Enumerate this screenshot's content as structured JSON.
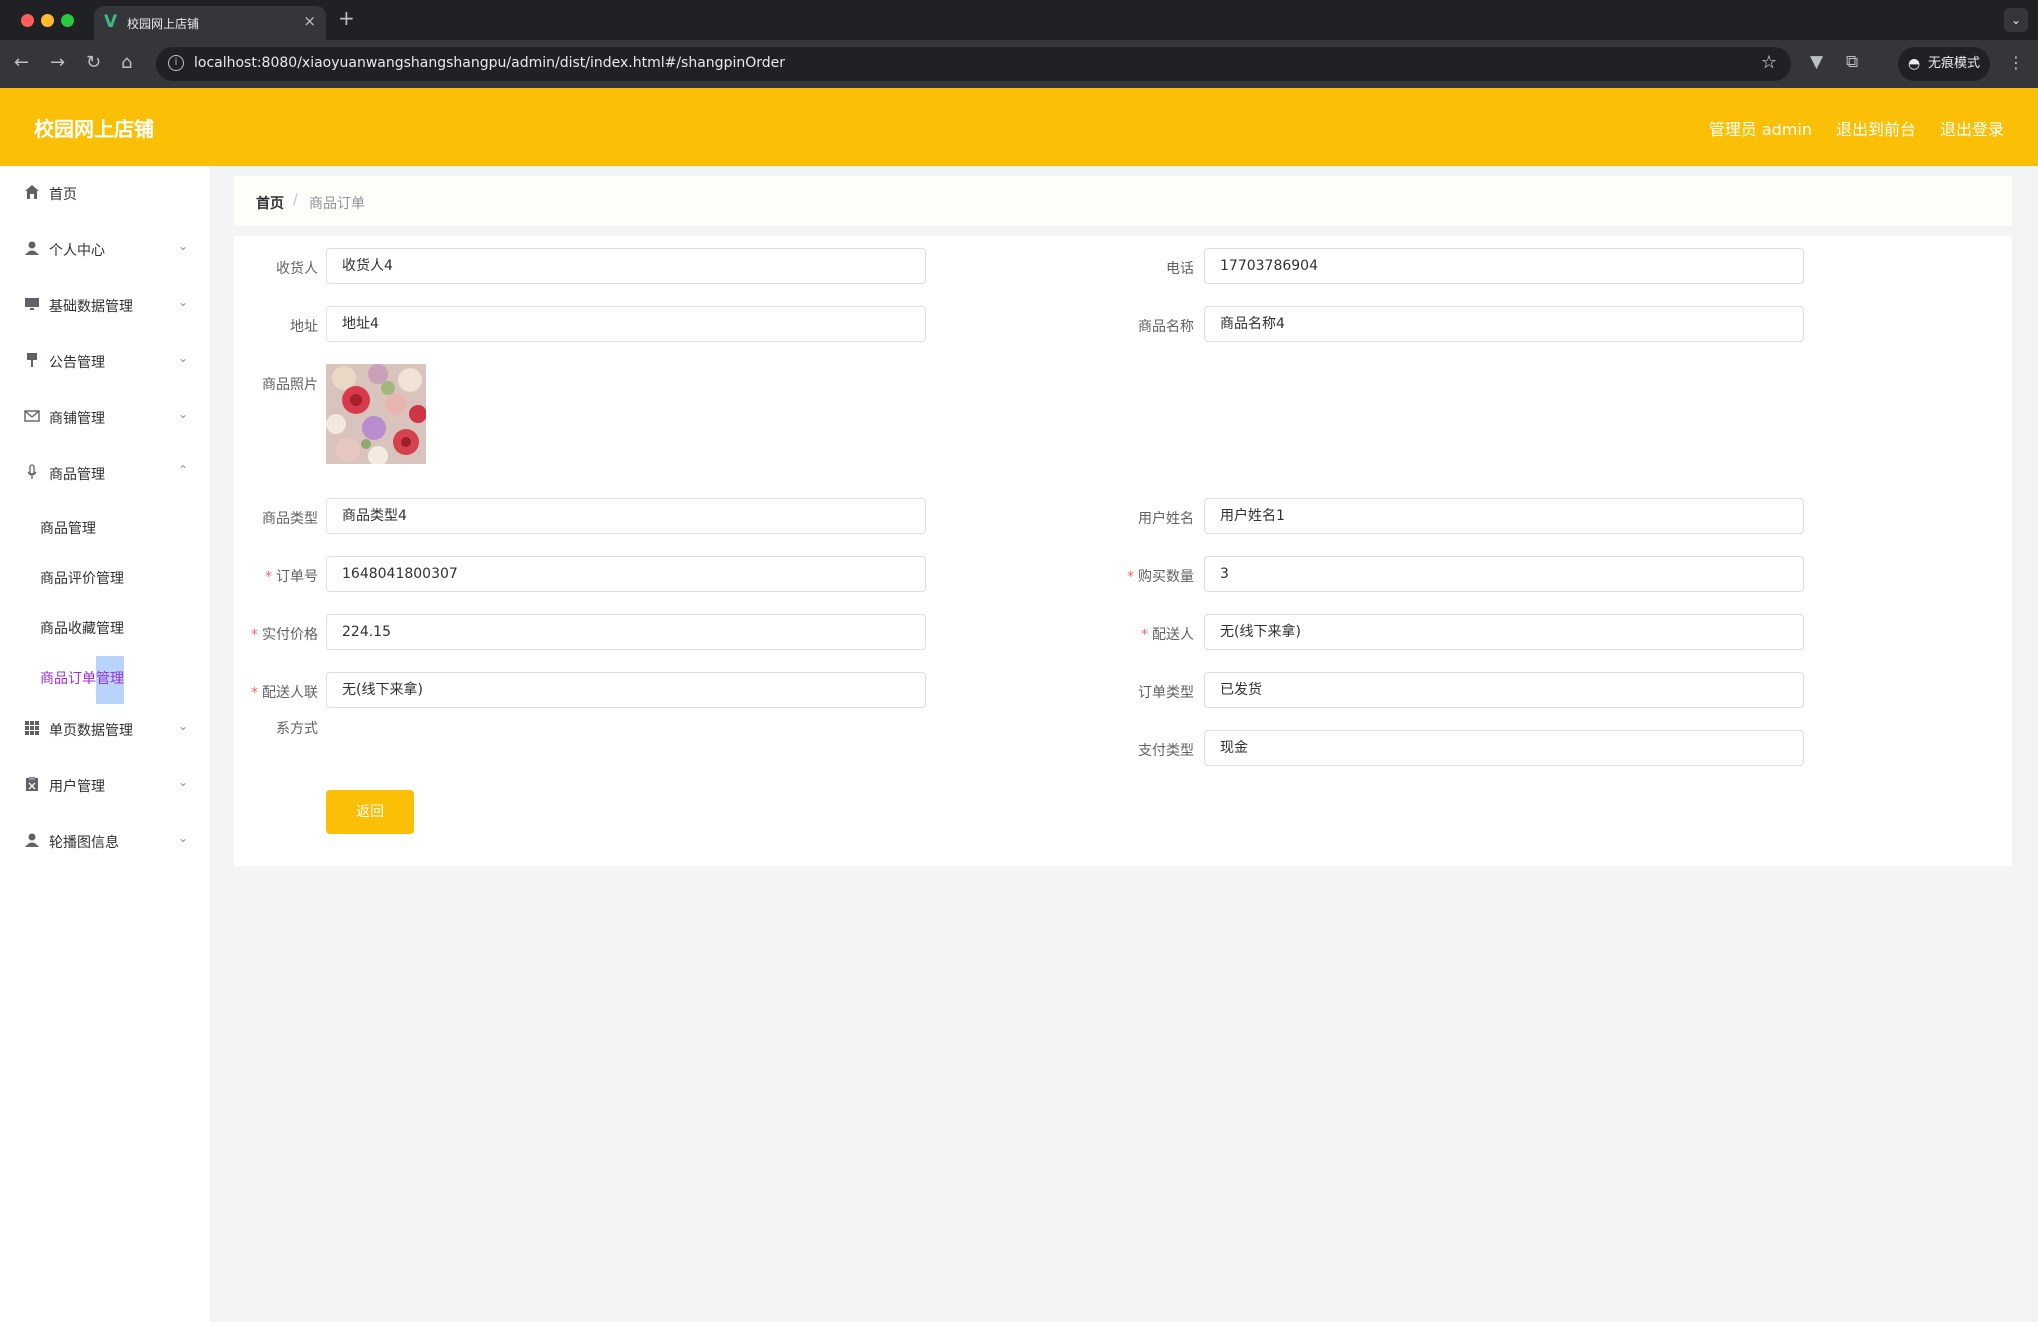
{
  "browser": {
    "tab_title": "校园网上店铺",
    "url": "localhost:8080/xiaoyuanwangshangshangpu/admin/dist/index.html#/shangpinOrder",
    "incognito_label": "无痕模式"
  },
  "header": {
    "title": "校园网上店铺",
    "admin_label": "管理员 admin",
    "to_frontend": "退出到前台",
    "logout": "退出登录"
  },
  "sidebar": {
    "items": [
      {
        "label": "首页",
        "icon": "home-icon"
      },
      {
        "label": "个人中心",
        "icon": "user-icon"
      },
      {
        "label": "基础数据管理",
        "icon": "monitor-icon"
      },
      {
        "label": "公告管理",
        "icon": "brush-icon"
      },
      {
        "label": "商铺管理",
        "icon": "mail-icon"
      },
      {
        "label": "商品管理",
        "icon": "microphone-icon"
      }
    ],
    "sub_items": [
      {
        "label": "商品管理"
      },
      {
        "label": "商品评价管理"
      },
      {
        "label": "商品收藏管理"
      },
      {
        "label": "商品订单管理"
      }
    ],
    "items_after": [
      {
        "label": "单页数据管理",
        "icon": "grid-icon"
      },
      {
        "label": "用户管理",
        "icon": "clipboard-icon"
      },
      {
        "label": "轮播图信息",
        "icon": "user-icon"
      }
    ]
  },
  "breadcrumb": {
    "home": "首页",
    "current": "商品订单"
  },
  "form": {
    "receiver": {
      "label": "收货人",
      "value": "收货人4"
    },
    "phone": {
      "label": "电话",
      "value": "17703786904"
    },
    "address": {
      "label": "地址",
      "value": "地址4"
    },
    "product_name": {
      "label": "商品名称",
      "value": "商品名称4"
    },
    "product_photo": {
      "label": "商品照片"
    },
    "product_type": {
      "label": "商品类型",
      "value": "商品类型4"
    },
    "user_name": {
      "label": "用户姓名",
      "value": "用户姓名1"
    },
    "order_no": {
      "label": "订单号",
      "value": "1648041800307"
    },
    "quantity": {
      "label": "购买数量",
      "value": "3"
    },
    "paid_price": {
      "label": "实付价格",
      "value": "224.15"
    },
    "deliverer": {
      "label": "配送人",
      "value": "无(线下来拿)"
    },
    "deliverer_contact": {
      "label_line1": "配送人联",
      "label_line2": "系方式",
      "value": "无(线下来拿)"
    },
    "order_type": {
      "label": "订单类型",
      "value": "已发货"
    },
    "payment_type": {
      "label": "支付类型",
      "value": "现金"
    },
    "back_button": "返回"
  },
  "colors": {
    "brand": "#fbbf05",
    "active_menu": "#9b2fd9",
    "required": "#f56c6c"
  }
}
